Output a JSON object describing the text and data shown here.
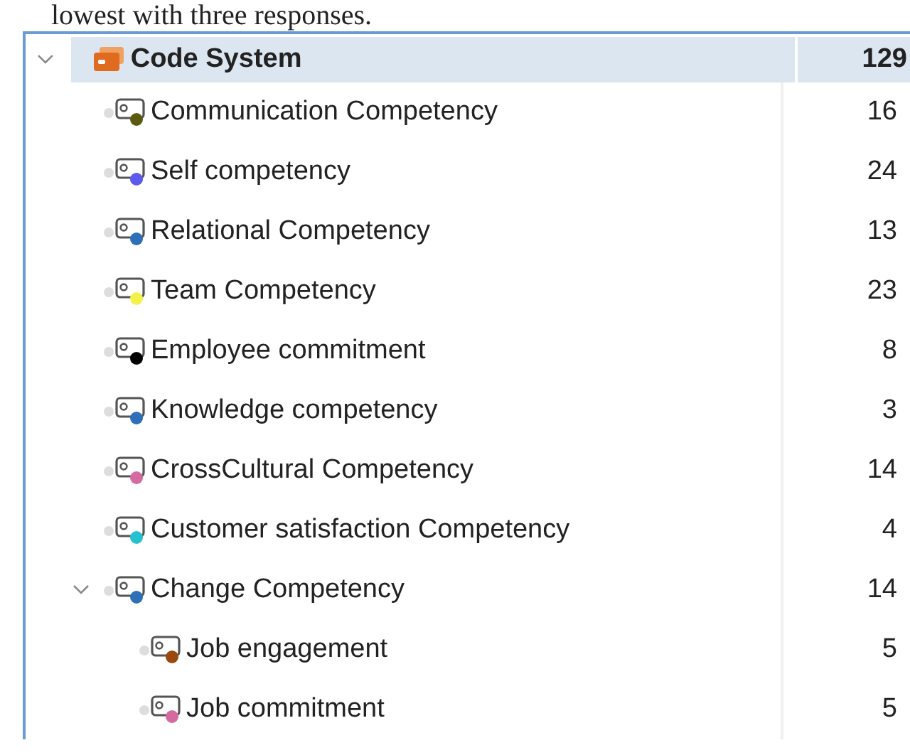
{
  "caption": "lowest with three responses.",
  "code_system": {
    "label": "Code System",
    "count": "129",
    "expanded": true,
    "children": [
      {
        "label": "Communication Competency",
        "count": "16",
        "color": "#5a5a10"
      },
      {
        "label": "Self competency",
        "count": "24",
        "color": "#5b5bf0"
      },
      {
        "label": "Relational Competency",
        "count": "13",
        "color": "#2f6fb8"
      },
      {
        "label": "Team Competency",
        "count": "23",
        "color": "#f4f24a"
      },
      {
        "label": "Employee commitment",
        "count": "8",
        "color": "#000000"
      },
      {
        "label": "Knowledge competency",
        "count": "3",
        "color": "#2f6fb8"
      },
      {
        "label": "CrossCultural Competency",
        "count": "14",
        "color": "#d46aa0"
      },
      {
        "label": "Customer satisfaction Competency",
        "count": "4",
        "color": "#27c0d0"
      },
      {
        "label": "Change Competency",
        "count": "14",
        "color": "#2f6fb8",
        "expanded": true,
        "children": [
          {
            "label": "Job engagement",
            "count": "5",
            "color": "#9a4a10"
          },
          {
            "label": "Job commitment",
            "count": "5",
            "color": "#d46aa0"
          }
        ]
      }
    ]
  }
}
